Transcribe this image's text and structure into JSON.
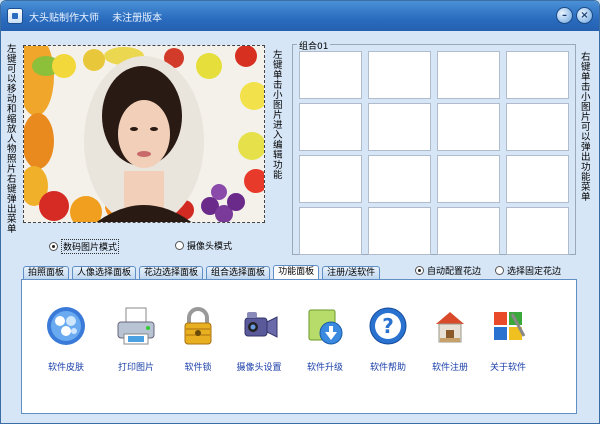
{
  "window": {
    "title": "大头贴制作大师",
    "subtitle": "未注册版本",
    "min_glyph": "–",
    "close_glyph": "×"
  },
  "photo": {
    "side_hint_left": "左键可以移动和缩放人物照片右键弹出菜单",
    "side_hint_right": "左键单击小图片进入编辑功能"
  },
  "group": {
    "label": "组合01",
    "side_hint": "右键单击小图片可以弹出功能菜单",
    "cell_count": 16
  },
  "mode": {
    "digital_label": "数码图片模式",
    "camera_label": "摄像头模式",
    "selected": "digital"
  },
  "frame_mode": {
    "auto_label": "自动配置花边",
    "fixed_label": "选择固定花边",
    "selected": "auto"
  },
  "tabs": [
    {
      "label": "拍照面板"
    },
    {
      "label": "人像选择面板"
    },
    {
      "label": "花边选择面板"
    },
    {
      "label": "组合选择面板"
    },
    {
      "label": "功能面板"
    },
    {
      "label": "注册/送软件"
    }
  ],
  "active_tab": 4,
  "tools": [
    {
      "label": "软件皮肤",
      "icon": "skin-icon"
    },
    {
      "label": "打印图片",
      "icon": "printer-icon"
    },
    {
      "label": "软件锁",
      "icon": "padlock-icon"
    },
    {
      "label": "摄像头设置",
      "icon": "camera-icon"
    },
    {
      "label": "软件升级",
      "icon": "upgrade-icon"
    },
    {
      "label": "软件帮助",
      "icon": "help-icon"
    },
    {
      "label": "软件注册",
      "icon": "register-icon"
    },
    {
      "label": "关于软件",
      "icon": "about-icon"
    }
  ],
  "colors": {
    "title_bar": "#2a6cbf",
    "window_bg": "#d6e6f7",
    "tool_label": "#1a3fa8"
  }
}
